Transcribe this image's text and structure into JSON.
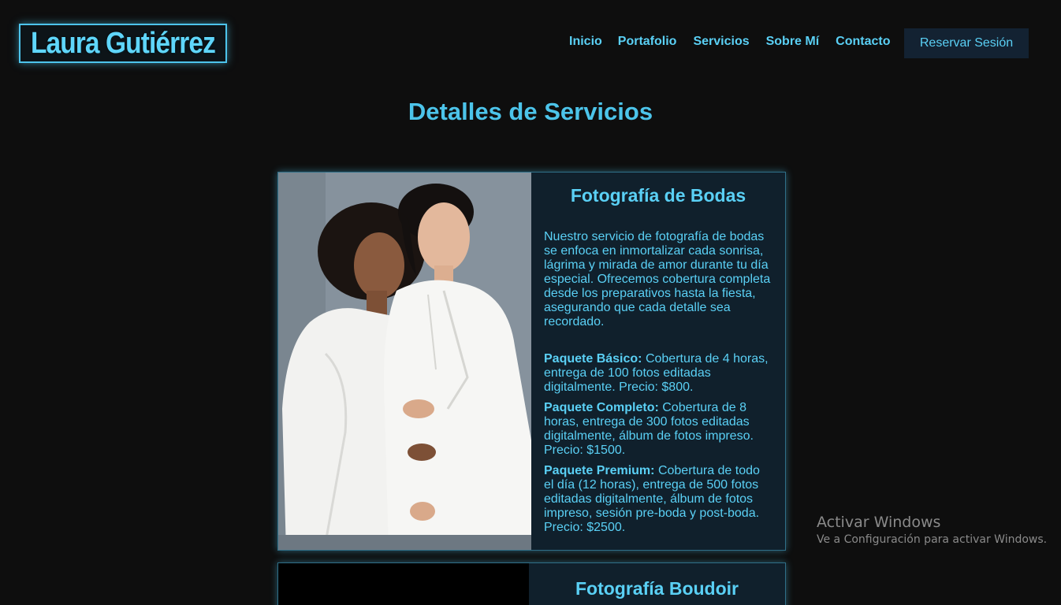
{
  "header": {
    "logo_text": "Laura Gutiérrez",
    "nav": [
      "Inicio",
      "Portafolio",
      "Servicios",
      "Sobre Mí",
      "Contacto"
    ],
    "cta_label": "Reservar Sesión"
  },
  "page_title": "Detalles de Servicios",
  "services": [
    {
      "title": "Fotografía de Bodas",
      "image": "two-women-in-white-suits-photo",
      "description": "Nuestro servicio de fotografía de bodas se enfoca en inmortalizar cada sonrisa, lágrima y mirada de amor durante tu día especial. Ofrecemos cobertura completa desde los preparativos hasta la fiesta, asegurando que cada detalle sea recordado.",
      "packages": [
        {
          "name": "Paquete Básico:",
          "text": "Cobertura de 4 horas, entrega de 100 fotos editadas digitalmente. Precio: $800."
        },
        {
          "name": "Paquete Completo:",
          "text": "Cobertura de 8 horas, entrega de 300 fotos editadas digitalmente, álbum de fotos impreso. Precio: $1500."
        },
        {
          "name": "Paquete Premium:",
          "text": "Cobertura de todo el día (12 horas), entrega de 500 fotos editadas digitalmente, álbum de fotos impreso, sesión pre-boda y post-boda. Precio: $2500."
        }
      ]
    },
    {
      "title": "Fotografía Boudoir",
      "image": "dark-photo"
    }
  ],
  "watermark": {
    "title": "Activar Windows",
    "subtitle": "Ve a Configuración para activar Windows."
  },
  "colors": {
    "background": "#0e0e0e",
    "accent": "#5ad0f5",
    "card_background": "#10202c",
    "button_background": "#132232"
  }
}
